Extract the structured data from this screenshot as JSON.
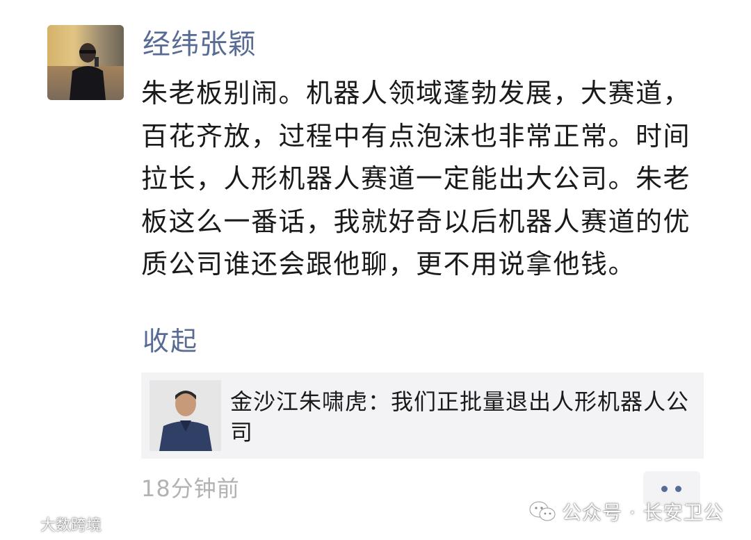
{
  "post": {
    "author_name": "经纬张颖",
    "text": "朱老板别闹。机器人领域蓬勃发展，大赛道，百花齐放，过程中有点泡沫也非常正常。时间拉长，人形机器人赛道一定能出大公司。朱老板这么一番话，我就好奇以后机器人赛道的优质公司谁还会跟他聊，更不用说拿他钱。",
    "collapse_label": "收起",
    "shared_link": {
      "title": "金沙江朱啸虎：我们正批量退出人形机器人公司"
    },
    "timestamp": "18分钟前"
  },
  "watermarks": {
    "account": "公众号 · 长安卫公",
    "bottom_left": "大数跨境"
  },
  "colors": {
    "link_blue": "#576b95",
    "text": "#1a1a1a",
    "time_gray": "#b2b2b2",
    "card_bg": "#f3f3f5"
  },
  "icons": {
    "avatar": "author-avatar-photo",
    "thumb": "shared-article-thumbnail",
    "more": "two-dot-more-icon",
    "wechat": "wechat-logo-icon"
  }
}
